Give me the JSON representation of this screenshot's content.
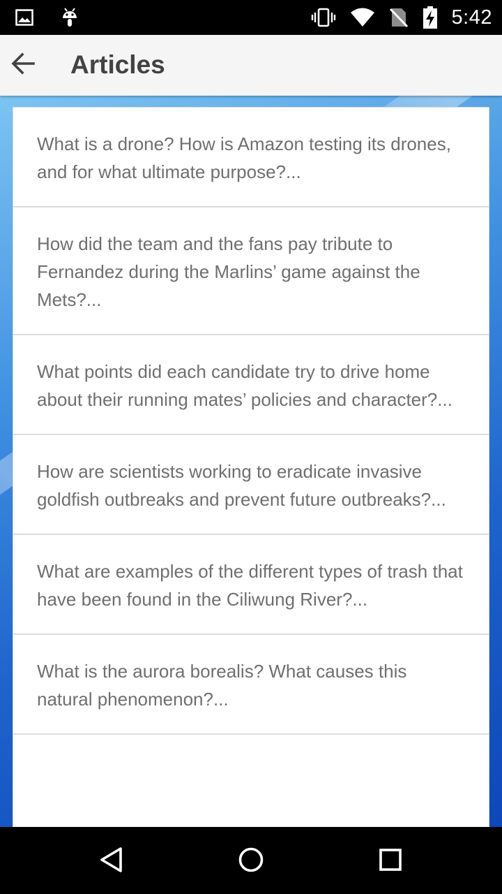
{
  "status_bar": {
    "time": "5:42",
    "icons": [
      "image-icon",
      "android-icon",
      "vibrate-icon",
      "wifi-icon",
      "no-sim-icon",
      "battery-charging-icon"
    ]
  },
  "app_bar": {
    "title": "Articles",
    "back_icon": "arrow-back-icon"
  },
  "articles": [
    {
      "text": "What is a drone? How is Amazon testing its drones, and for what ultimate purpose?..."
    },
    {
      "text": "How did the team and the fans pay tribute to Fernandez during the Marlins’ game against the Mets?..."
    },
    {
      "text": "What points did each candidate try to drive home about their running mates’ policies and character?..."
    },
    {
      "text": "How are scientists working to eradicate invasive goldfish outbreaks and prevent future outbreaks?..."
    },
    {
      "text": "What are examples of the different types of trash that have been found in the Ciliwung River?..."
    },
    {
      "text": "What is the aurora borealis? What causes this natural phenomenon?..."
    },
    {
      "text": ""
    }
  ],
  "nav_bar": {
    "buttons": [
      "back-triangle-icon",
      "home-circle-icon",
      "recents-square-icon"
    ]
  },
  "colors": {
    "status_bar": "#000000",
    "app_bar": "#f5f5f5",
    "title_text": "#424242",
    "item_text": "#6f6f6f",
    "wallpaper": "#1e63cc"
  }
}
